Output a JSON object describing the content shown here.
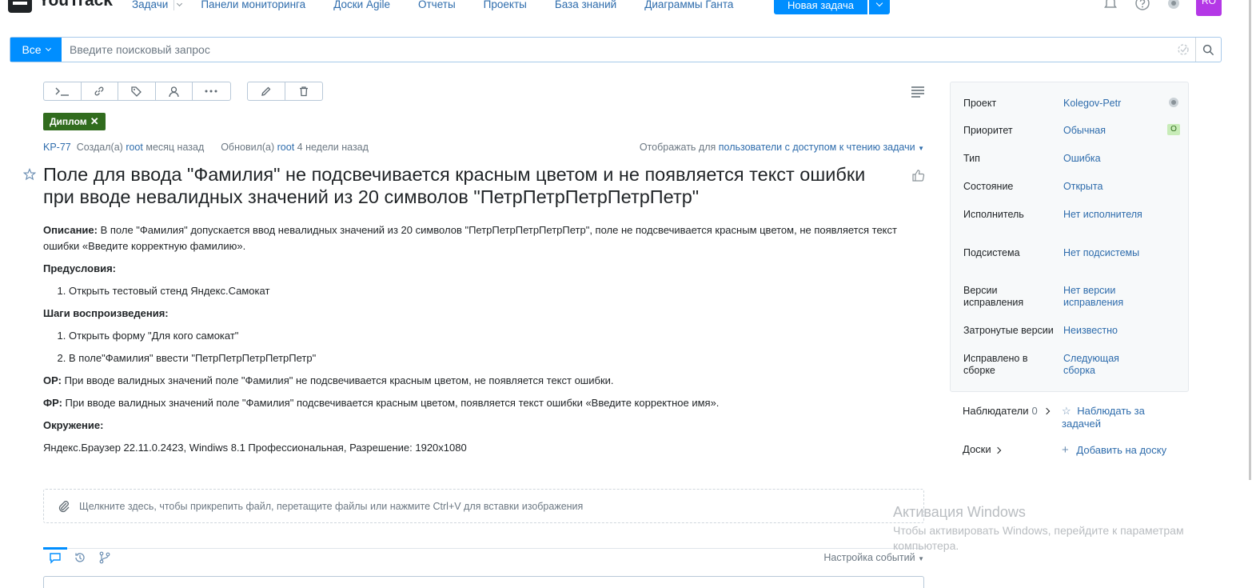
{
  "header": {
    "app_name": "YouTrack",
    "nav": [
      "Задачи",
      "Панели мониторинга",
      "Доски Agile",
      "Отчеты",
      "Проекты",
      "База знаний",
      "Диаграммы Ганта"
    ],
    "new_task": "Новая задача",
    "avatar_initials": "RO",
    "icons": [
      "bell-icon",
      "help-icon",
      "settings-icon"
    ]
  },
  "search": {
    "scope": "Все",
    "placeholder": "Введите поисковый запрос"
  },
  "issue": {
    "tag": "Диплом",
    "id": "KP-77",
    "created_prefix": "Создал(а)",
    "created_user": "root",
    "created_time": "месяц назад",
    "updated_prefix": "Обновил(а)",
    "updated_user": "root",
    "updated_time": "4 недели назад",
    "visibility_prefix": "Отображать для",
    "visibility_value": "пользователи с доступом к чтению задачи",
    "title": "Поле для ввода \"Фамилия\" не подсвечивается красным цветом и не появляется текст ошибки при вводе невалидных значений из 20 символов \"ПетрПетрПетрПетрПетр\""
  },
  "description": {
    "desc_label": "Описание:",
    "desc_text": " В поле \"Фамилия\" допускается ввод невалидных значений из 20 символов \"ПетрПетрПетрПетрПетр\", поле не подсвечивается красным цветом, не появляется текст ошибки «Введите корректную фамилию».",
    "pre_label": "Предусловия:",
    "pre_items": [
      "Открыть тестовый стенд Яндекс.Самокат"
    ],
    "steps_label": "Шаги воспроизведения:",
    "steps_items": [
      "Открыть форму \"Для кого самокат\"",
      "В поле\"Фамилия\" ввести \"ПетрПетрПетрПетрПетр\""
    ],
    "or_label": "ОР:",
    "or_text": " При вводе валидных значений поле \"Фамилия\" не подсвечивается красным цветом, не появляется текст ошибки.",
    "fr_label": "ФР:",
    "fr_text": " При вводе валидных значений поле \"Фамилия\" подсвечивается красным цветом, появляется текст ошибки «Введите корректное имя».",
    "env_label": "Окружение:",
    "env_text": "Яндекс.Браузер 22.11.0.2423, Windiws 8.1 Профессиональная, Разрешение: 1920x1080"
  },
  "attach_hint": "Щелкните здесь, чтобы прикрепить файл, перетащите файлы или нажмите Ctrl+V для вставки изображения",
  "activity": {
    "settings": "Настройка событий"
  },
  "fields": [
    {
      "label": "Проект",
      "value": "Kolegov-Petr"
    },
    {
      "label": "Приоритет",
      "value": "Обычная",
      "badge": "O"
    },
    {
      "label": "Тип",
      "value": "Ошибка"
    },
    {
      "label": "Состояние",
      "value": "Открыта"
    },
    {
      "label": "Исполнитель",
      "value": "Нет исполнителя"
    },
    {
      "label": "Подсистема",
      "value": "Нет подсистемы"
    },
    {
      "label": "Версии исправления",
      "value": "Нет версии исправления"
    },
    {
      "label": "Затронутые версии",
      "value": "Неизвестно"
    },
    {
      "label": "Исправлено в сборке",
      "value": "Следующая сборка"
    }
  ],
  "watchers": {
    "label": "Наблюдатели",
    "count": "0",
    "watch_link": "Наблюдать за задачей"
  },
  "boards": {
    "label": "Доски",
    "add_link": "Добавить на доску"
  },
  "windows_activation": {
    "title": "Активация Windows",
    "text": "Чтобы активировать Windows, перейдите к параметрам компьютера."
  },
  "colors": {
    "accent": "#008eff",
    "link": "#2e6cac",
    "tag": "#316c1e",
    "avatar": "#b438e6"
  }
}
